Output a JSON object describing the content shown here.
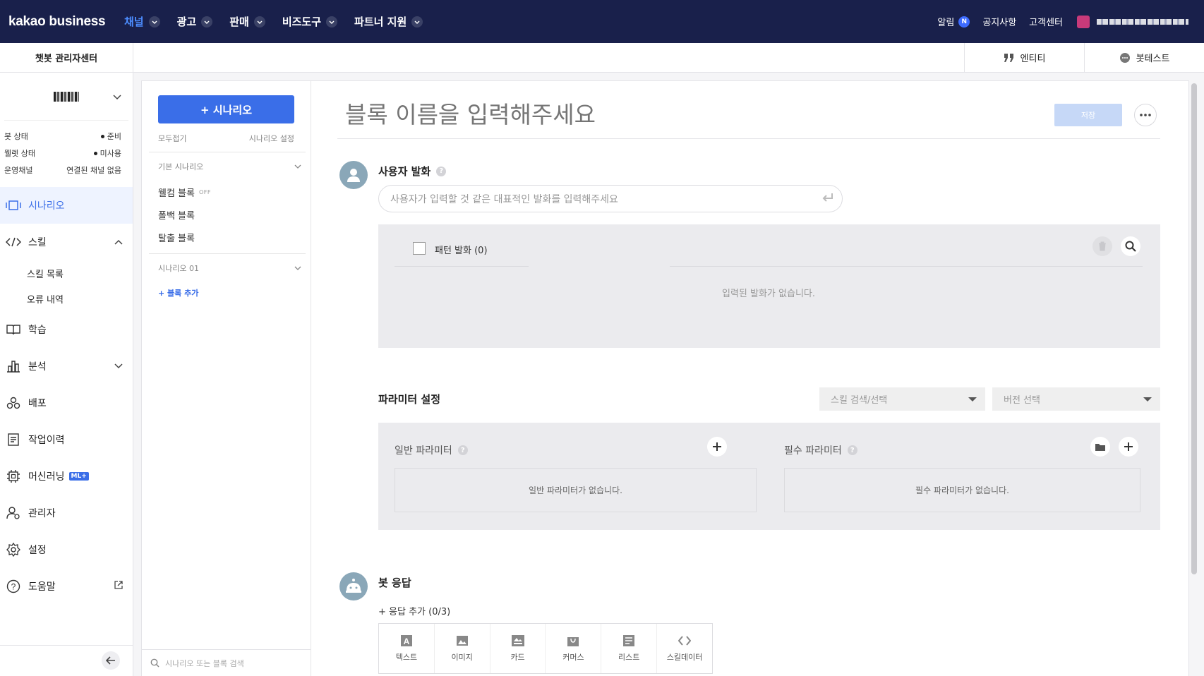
{
  "topnav": {
    "brand": "kakao business",
    "menu": [
      {
        "label": "채널",
        "active": true
      },
      {
        "label": "광고",
        "active": false
      },
      {
        "label": "판매",
        "active": false
      },
      {
        "label": "비즈도구",
        "active": false
      },
      {
        "label": "파트너 지원",
        "active": false
      }
    ],
    "right": {
      "notifications": "알림",
      "notification_badge": "N",
      "notice": "공지사항",
      "support": "고객센터"
    }
  },
  "subheader": {
    "title": "챗봇 관리자센터",
    "entity": "엔티티",
    "bottest": "봇테스트"
  },
  "sidebar": {
    "status": [
      {
        "label": "봇 상태",
        "value": "준비",
        "dot": true
      },
      {
        "label": "웰렛 상태",
        "value": "미사용",
        "dot": true
      },
      {
        "label": "운영채널",
        "value": "연결된 채널 없음",
        "dot": false
      }
    ],
    "nav": {
      "scenario": "시나리오",
      "skill": "스킬",
      "skill_list": "스킬 목록",
      "error_log": "오류 내역",
      "learning": "학습",
      "analysis": "분석",
      "deploy": "배포",
      "history": "작업이력",
      "ml": "머신러닝",
      "ml_badge": "ML+",
      "admin": "관리자",
      "settings": "설정",
      "help": "도움말"
    }
  },
  "scenario_panel": {
    "add_button": "+ 시나리오",
    "collapse_all": "모두접기",
    "scenario_settings": "시나리오 설정",
    "groups": [
      {
        "title": "기본 시나리오",
        "blocks": [
          {
            "label": "웰컴 블록",
            "tag": "OFF"
          },
          {
            "label": "폴백 블록",
            "tag": ""
          },
          {
            "label": "탈출 블록",
            "tag": ""
          }
        ]
      },
      {
        "title": "시나리오 01",
        "blocks": []
      }
    ],
    "add_block": "+ 블록 추가",
    "search_placeholder": "시나리오 또는 블록 검색"
  },
  "editor": {
    "block_name_placeholder": "블록 이름을 입력해주세요",
    "save": "저장",
    "user_utterance": {
      "title": "사용자 발화",
      "placeholder": "사용자가 입력할 것 같은 대표적인 발화를 입력해주세요",
      "pattern_label": "패턴 발화 (0)",
      "empty": "입력된 발화가 없습니다."
    },
    "parameters": {
      "title": "파라미터 설정",
      "skill_select": "스킬 검색/선택",
      "version_select": "버전 선택",
      "general_title": "일반 파라미터",
      "general_empty": "일반 파라미터가 없습니다.",
      "required_title": "필수 파라미터",
      "required_empty": "필수 파라미터가 없습니다."
    },
    "bot_response": {
      "title": "봇 응답",
      "add": "+ 응답 추가 (0/3)",
      "types": [
        "텍스트",
        "이미지",
        "카드",
        "커머스",
        "리스트",
        "스킬데이터"
      ]
    }
  },
  "colors": {
    "nav_bg": "#19204b",
    "accent": "#3a6ee8"
  }
}
